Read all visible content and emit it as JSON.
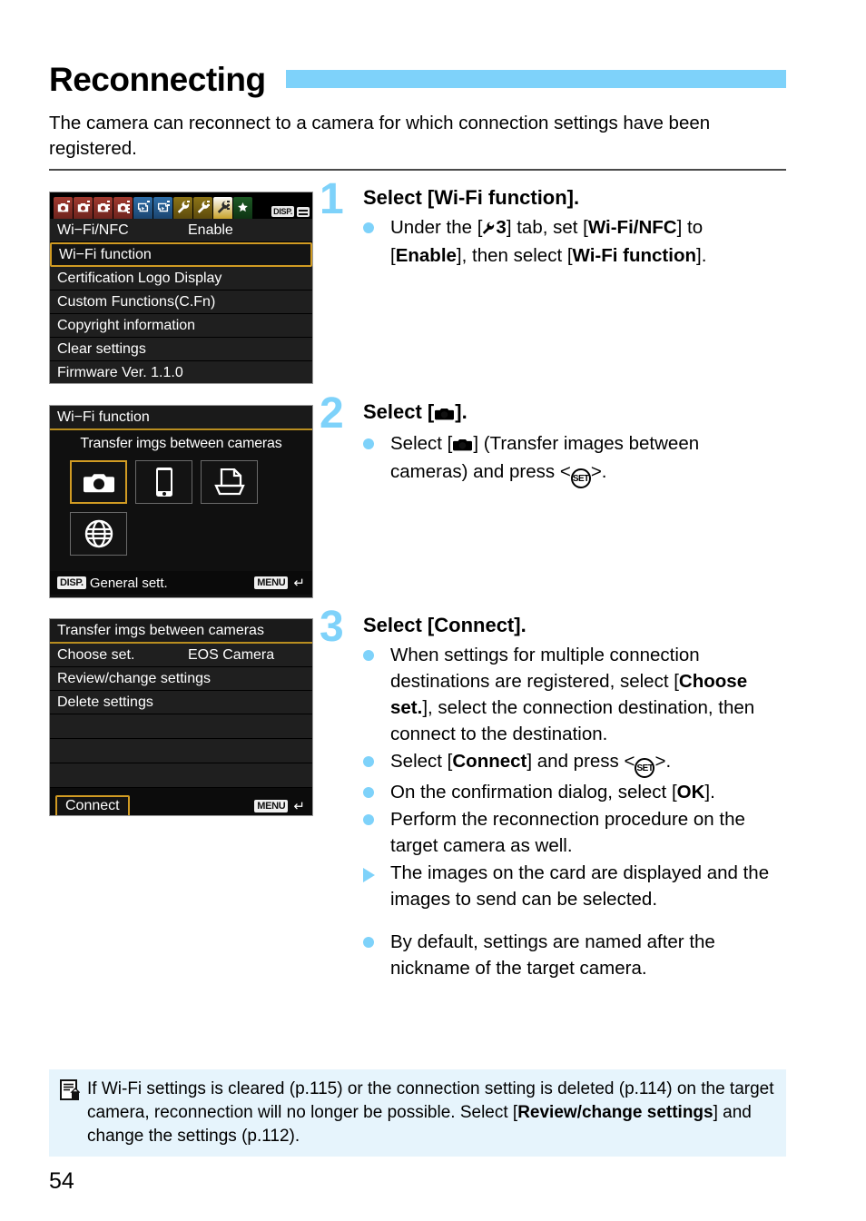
{
  "document": {
    "title": "Reconnecting",
    "intro": "The camera can reconnect to a camera for which connection settings have been registered.",
    "page_number": "54",
    "accent_color": "#7ed2fa",
    "note_bg_color": "#e6f4fc",
    "menu_highlight_color": "#d19b23"
  },
  "screenshot1": {
    "name": "setup-menu-wifi",
    "tabs": [
      {
        "type": "shooting",
        "color": "red",
        "active": false
      },
      {
        "type": "shooting",
        "color": "red",
        "active": false
      },
      {
        "type": "shooting",
        "color": "red",
        "active": false
      },
      {
        "type": "shooting",
        "color": "red",
        "active": false
      },
      {
        "type": "playback",
        "color": "blue",
        "active": false
      },
      {
        "type": "playback",
        "color": "blue",
        "active": false
      },
      {
        "type": "setup",
        "color": "yellow",
        "active": false
      },
      {
        "type": "setup",
        "color": "yellow",
        "active": false
      },
      {
        "type": "setup",
        "color": "yellow",
        "active": true
      },
      {
        "type": "mymenu",
        "color": "green",
        "active": false
      }
    ],
    "badges": {
      "disp": "DISP.",
      "grid": "grid-icon"
    },
    "rows": [
      {
        "label": "Wi−Fi/NFC",
        "value": "Enable",
        "selected": false
      },
      {
        "label": "Wi−Fi function",
        "value": "",
        "selected": true
      },
      {
        "label": "Certification Logo Display",
        "value": "",
        "selected": false
      },
      {
        "label": "Custom Functions(C.Fn)",
        "value": "",
        "selected": false
      },
      {
        "label": "Copyright information",
        "value": "",
        "selected": false
      },
      {
        "label": "Clear settings",
        "value": "",
        "selected": false
      },
      {
        "label": "Firmware Ver. 1.1.0",
        "value": "",
        "selected": false
      }
    ]
  },
  "screenshot2": {
    "name": "wifi-function-screen",
    "header": "Wi−Fi function",
    "caption": "Transfer imgs between cameras",
    "tiles": [
      {
        "icon": "camera-icon",
        "selected": true
      },
      {
        "icon": "smartphone-icon",
        "selected": false
      },
      {
        "icon": "printer-icon",
        "selected": false
      },
      {
        "icon": "globe-icon",
        "selected": false
      }
    ],
    "footer": {
      "disp_badge": "DISP.",
      "disp_label": "General sett.",
      "menu_badge": "MENU",
      "return_arrow": "↶"
    }
  },
  "screenshot3": {
    "name": "transfer-imgs-screen",
    "header": "Transfer imgs between cameras",
    "rows": [
      {
        "label": "Choose set.",
        "value": "EOS Camera"
      },
      {
        "label": "Review/change settings",
        "value": ""
      },
      {
        "label": "Delete settings",
        "value": ""
      }
    ],
    "blank_rows": 3,
    "connect_button": "Connect",
    "footer": {
      "menu_badge": "MENU",
      "return_arrow": "↶"
    }
  },
  "steps": [
    {
      "number": "1",
      "heading": "Select [Wi-Fi function].",
      "bullets": [
        {
          "mark": "dot",
          "segments": [
            {
              "text": "Under the [",
              "bold": false
            },
            {
              "text": "wrench-icon",
              "icon": true
            },
            {
              "text": "3",
              "bold": true
            },
            {
              "text": "] tab, set [",
              "bold": false
            },
            {
              "text": "Wi-Fi/NFC",
              "bold": true
            },
            {
              "text": "] to [",
              "bold": false
            },
            {
              "text": "Enable",
              "bold": true
            },
            {
              "text": "], then select [",
              "bold": false
            },
            {
              "text": "Wi-Fi function",
              "bold": true
            },
            {
              "text": "].",
              "bold": false
            }
          ]
        }
      ]
    },
    {
      "number": "2",
      "heading": "Select [camera-icon].",
      "bullets": [
        {
          "mark": "dot",
          "segments": [
            {
              "text": "Select [",
              "bold": false
            },
            {
              "text": "camera-icon",
              "icon": true
            },
            {
              "text": "] (Transfer images between cameras) and press <",
              "bold": false
            },
            {
              "text": "SET",
              "key": true
            },
            {
              "text": ">.",
              "bold": false
            }
          ]
        }
      ]
    },
    {
      "number": "3",
      "heading": "Select [Connect].",
      "bullets": [
        {
          "mark": "dot",
          "segments": [
            {
              "text": "When settings for multiple connection destinations are registered, select [",
              "bold": false
            },
            {
              "text": "Choose set.",
              "bold": true
            },
            {
              "text": "], select the connection destination, then connect to the destination.",
              "bold": false
            }
          ]
        },
        {
          "mark": "dot",
          "segments": [
            {
              "text": "Select [",
              "bold": false
            },
            {
              "text": "Connect",
              "bold": true
            },
            {
              "text": "] and press <",
              "bold": false
            },
            {
              "text": "SET",
              "key": true
            },
            {
              "text": ">.",
              "bold": false
            }
          ]
        },
        {
          "mark": "dot",
          "segments": [
            {
              "text": "On the confirmation dialog, select [",
              "bold": false
            },
            {
              "text": "OK",
              "bold": true
            },
            {
              "text": "].",
              "bold": false
            }
          ]
        },
        {
          "mark": "dot",
          "segments": [
            {
              "text": "Perform the reconnection procedure on the target camera as well.",
              "bold": false
            }
          ]
        },
        {
          "mark": "triangle",
          "segments": [
            {
              "text": "The images on the card are displayed and the images to send can be selected.",
              "bold": false
            }
          ]
        },
        {
          "mark": "dot",
          "gap": true,
          "segments": [
            {
              "text": "By default, settings are named after the nickname of the target camera.",
              "bold": false
            }
          ]
        }
      ]
    }
  ],
  "note": {
    "icon": "note-document-icon",
    "segments": [
      {
        "text": "If Wi-Fi settings is cleared (p.115) or the connection setting is deleted (p.114) on the target camera, reconnection will no longer be possible. Select [",
        "bold": false
      },
      {
        "text": "Review/change settings",
        "bold": true
      },
      {
        "text": "] and change the settings (p.112).",
        "bold": false
      }
    ]
  }
}
